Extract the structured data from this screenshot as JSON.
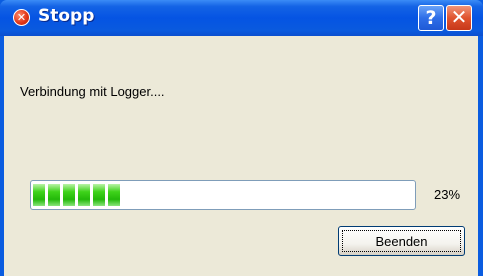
{
  "window": {
    "title": "Stopp",
    "icon": "error-icon",
    "title_bar_color": "#0554e3"
  },
  "title_buttons": {
    "help_label": "?",
    "close_label": "✕"
  },
  "dialog": {
    "status_text": "Verbindung mit Logger....",
    "progress": {
      "value_percent": 23,
      "label": "23%",
      "fill_color": "#23b80a"
    },
    "buttons": {
      "end_label": "Beenden"
    }
  }
}
